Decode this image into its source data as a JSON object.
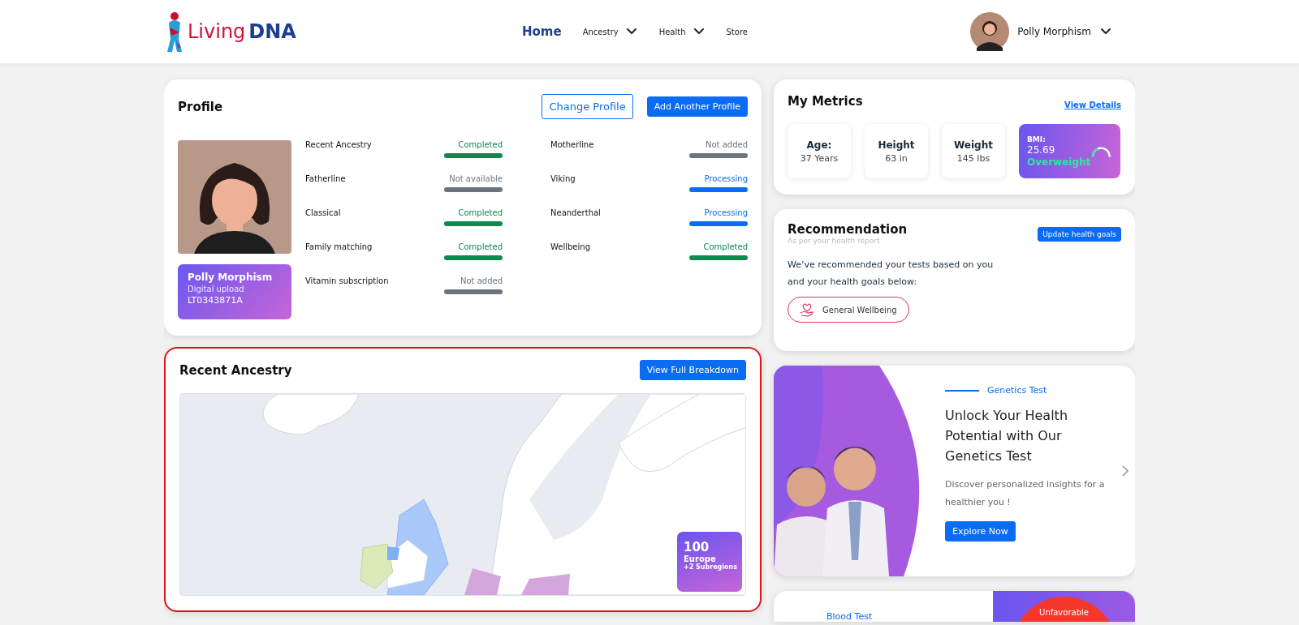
{
  "header": {
    "logo": {
      "word_1": "Living",
      "word_2": "DNA"
    },
    "nav": [
      {
        "label": "Home",
        "selected": true,
        "has_menu": false
      },
      {
        "label": "Ancestry",
        "selected": false,
        "has_menu": true
      },
      {
        "label": "Health",
        "selected": false,
        "has_menu": true
      },
      {
        "label": "Store",
        "selected": false,
        "has_menu": false
      }
    ],
    "user": {
      "name": "Polly Morphism"
    }
  },
  "profile": {
    "title": "Profile",
    "buttons": [
      {
        "label": "Change Profile",
        "kind": "outline"
      },
      {
        "label": "Add Another Profile",
        "kind": "primary"
      }
    ],
    "person": {
      "name": "Polly Morphism",
      "source": "Digital upload",
      "id": "LT0343871A"
    },
    "tests": {
      "column_1": [
        {
          "label": "Recent Ancestry",
          "status": "Completed",
          "kind": "completed"
        },
        {
          "label": "Fatherline",
          "status": "Not available",
          "kind": "inactive"
        },
        {
          "label": "Classical",
          "status": "Completed",
          "kind": "completed"
        },
        {
          "label": "Family matching",
          "status": "Completed",
          "kind": "completed"
        },
        {
          "label": "Vitamin subscription",
          "status": "Not added",
          "kind": "inactive"
        }
      ],
      "column_2": [
        {
          "label": "Motherline",
          "status": "Not added",
          "kind": "inactive"
        },
        {
          "label": "Viking",
          "status": "Processing",
          "kind": "processing"
        },
        {
          "label": "Neanderthal",
          "status": "Processing",
          "kind": "processing"
        },
        {
          "label": "Wellbeing",
          "status": "Completed",
          "kind": "completed"
        }
      ]
    }
  },
  "ancestry": {
    "title": "Recent Ancestry",
    "button": "View Full Breakdown",
    "highlighted": true,
    "badge": {
      "percent": "100",
      "region": "Europe",
      "subregions": "+2 Subregions"
    }
  },
  "metrics": {
    "title": "My Metrics",
    "link": "View Details",
    "items": [
      {
        "label": "Age:",
        "value": "37 Years"
      },
      {
        "label": "Height",
        "value": "63 in"
      },
      {
        "label": "Weight",
        "value": "145 lbs"
      }
    ],
    "bmi": {
      "label": "BMI:",
      "value": "25.69",
      "status": "Overweight"
    }
  },
  "recommendation": {
    "title": "Recommendation",
    "subtitle": "As per your health report",
    "button": "Update health goals",
    "text": "We’ve recommended your tests based on you and your health goals below:",
    "goals": [
      {
        "label": "General Wellbeing"
      }
    ]
  },
  "promo": {
    "eyebrow": "Genetics Test",
    "title": "Unlock Your Health Potential with Our Genetics Test",
    "text": "Discover personalized insights for a healthier you !",
    "button": "Explore Now"
  },
  "blood_card": {
    "eyebrow": "Blood Test",
    "badge": "Unfavorable"
  }
}
